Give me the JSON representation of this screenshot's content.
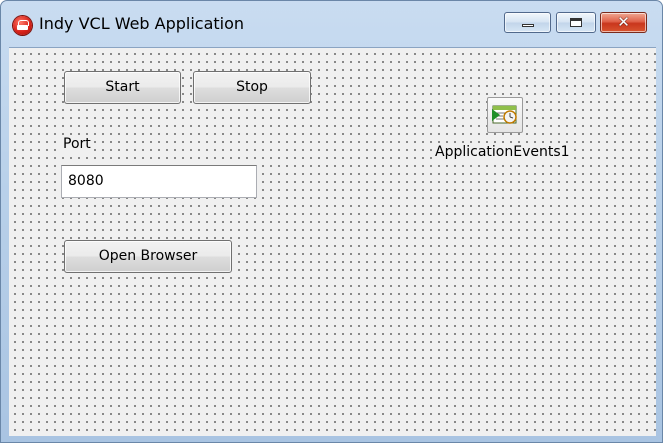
{
  "window": {
    "title": "Indy VCL Web Application",
    "icon": "indy-app-icon",
    "controls": {
      "minimize": "minimize-icon",
      "maximize": "maximize-icon",
      "close_glyph": "✕"
    }
  },
  "form": {
    "start_label": "Start",
    "stop_label": "Stop",
    "port_label": "Port",
    "port_value": "8080",
    "open_browser_label": "Open Browser",
    "component": {
      "name": "ApplicationEvents1",
      "icon": "application-events-icon"
    }
  },
  "colors": {
    "frame": "#b9d1ea",
    "canvas": "#f0f0f0",
    "close_button": "#c9361d"
  }
}
